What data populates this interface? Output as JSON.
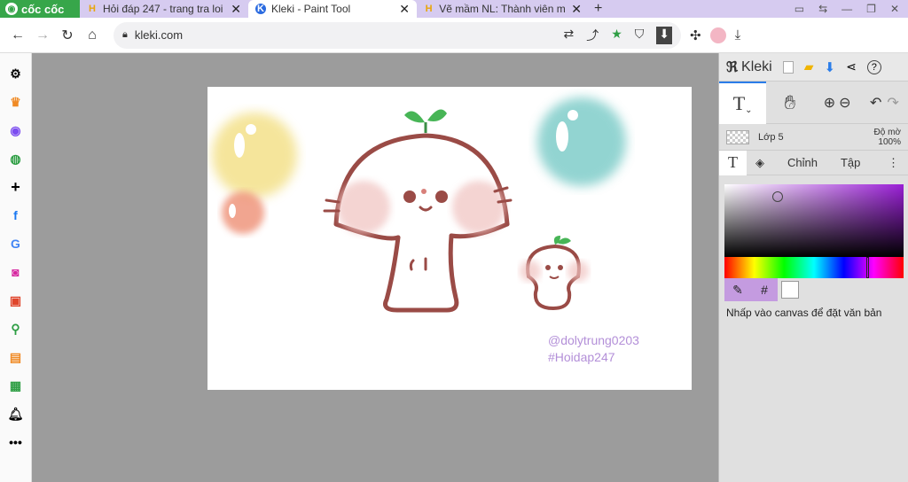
{
  "browser": {
    "brand": "cốc cốc",
    "tabs": [
      {
        "label": "Hỏi đáp 247 - trang tra loi",
        "favicon": "H"
      },
      {
        "label": "Kleki - Paint Tool",
        "favicon": "K",
        "active": true
      },
      {
        "label": "Vẽ mầm NL: Thành viên mới",
        "favicon": "H"
      }
    ],
    "url": "kleki.com"
  },
  "canvas_text": {
    "line1": "@dolytrung0203",
    "line2": "#Hoidap247"
  },
  "kleki": {
    "logo": "Kleki",
    "layer_name": "Lớp 5",
    "opacity_label": "Độ mờ",
    "opacity_value": "100%",
    "tab_adjust": "Chỉnh",
    "tab_file": "Tập",
    "hex_symbol": "#",
    "hint": "Nhấp vào canvas để đặt văn bản",
    "text_tool": "T"
  },
  "colors": {
    "accent": "#2b7de9",
    "brand": "#37a64a",
    "tabbar": "#d6cbf0"
  }
}
